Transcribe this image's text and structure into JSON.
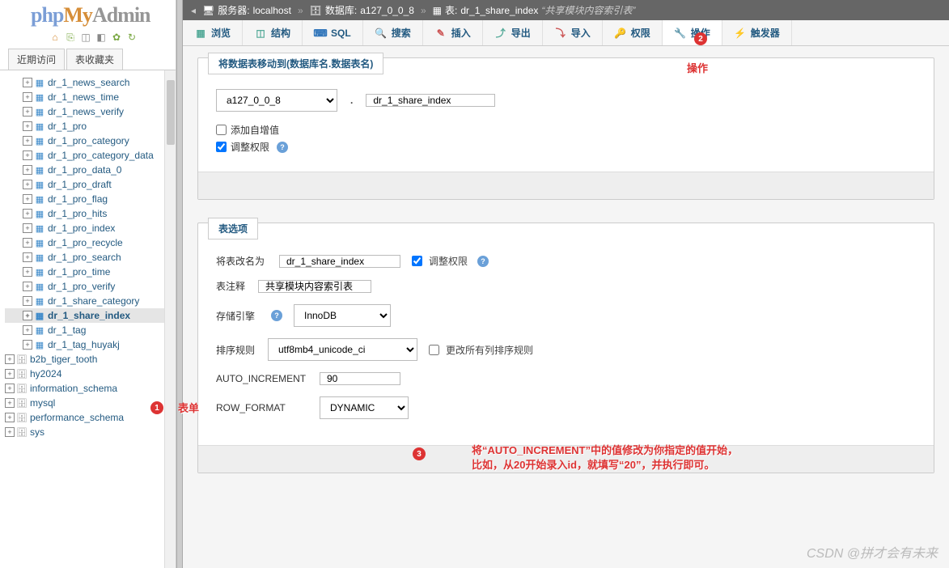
{
  "logo": {
    "p1": "php",
    "p2": "My",
    "p3": "Admin"
  },
  "nav_tabs": {
    "recent": "近期访问",
    "favorites": "表收藏夹"
  },
  "tree_tables": [
    "dr_1_news_search",
    "dr_1_news_time",
    "dr_1_news_verify",
    "dr_1_pro",
    "dr_1_pro_category",
    "dr_1_pro_category_data",
    "dr_1_pro_data_0",
    "dr_1_pro_draft",
    "dr_1_pro_flag",
    "dr_1_pro_hits",
    "dr_1_pro_index",
    "dr_1_pro_recycle",
    "dr_1_pro_search",
    "dr_1_pro_time",
    "dr_1_pro_verify",
    "dr_1_share_category",
    "dr_1_share_index",
    "dr_1_tag",
    "dr_1_tag_huyakj"
  ],
  "tree_selected_index": 16,
  "tree_dbs": [
    "b2b_tiger_tooth",
    "hy2024",
    "information_schema",
    "mysql",
    "performance_schema",
    "sys"
  ],
  "breadcrumb": {
    "server_lbl": "服务器:",
    "server": "localhost",
    "db_lbl": "数据库:",
    "db": "a127_0_0_8",
    "table_lbl": "表:",
    "table": "dr_1_share_index",
    "comment": "“共享模块内容索引表”"
  },
  "tabs": [
    "浏览",
    "结构",
    "SQL",
    "搜索",
    "插入",
    "导出",
    "导入",
    "权限",
    "操作",
    "触发器"
  ],
  "tabs_active": 8,
  "panel1": {
    "legend": "将数据表移动到(数据库名.数据表名)",
    "db_select": "a127_0_0_8",
    "dot": ".",
    "table_input": "dr_1_share_index",
    "cb1": "添加自增值",
    "cb2": "调整权限"
  },
  "panel2": {
    "legend": "表选项",
    "rename_lbl": "将表改名为",
    "rename_val": "dr_1_share_index",
    "adjust_priv": "调整权限",
    "comment_lbl": "表注释",
    "comment_val": "共享模块内容索引表",
    "engine_lbl": "存储引擎",
    "engine_val": "InnoDB",
    "collation_lbl": "排序规则",
    "collation_val": "utf8mb4_unicode_ci",
    "collation_cb": "更改所有列排序规则",
    "ai_lbl": "AUTO_INCREMENT",
    "ai_val": "90",
    "rf_lbl": "ROW_FORMAT",
    "rf_val": "DYNAMIC"
  },
  "annotations": {
    "b1": "1",
    "t1": "表单",
    "b2": "2",
    "t2": "操作",
    "b3": "3",
    "t3a": "将“AUTO_INCREMENT”中的值修改为你指定的值开始，",
    "t3b": "比如，从20开始录入id，就填写“20”，并执行即可。"
  },
  "watermark": "CSDN @拼才会有未来"
}
